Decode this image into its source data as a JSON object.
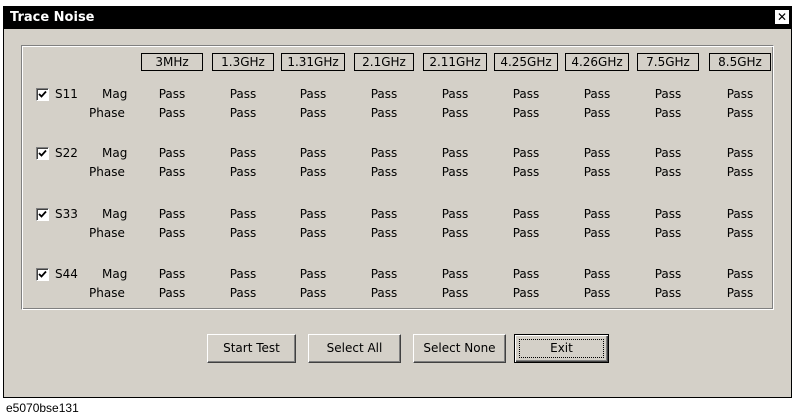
{
  "window": {
    "title": "Trace Noise",
    "close_glyph": "✕"
  },
  "frequencies": [
    "3MHz",
    "1.3GHz",
    "1.31GHz",
    "2.1GHz",
    "2.11GHz",
    "4.25GHz",
    "4.26GHz",
    "7.5GHz",
    "8.5GHz"
  ],
  "ports": [
    {
      "name": "S11",
      "checked": true,
      "rows": [
        {
          "label": "Mag",
          "results": [
            "Pass",
            "Pass",
            "Pass",
            "Pass",
            "Pass",
            "Pass",
            "Pass",
            "Pass",
            "Pass"
          ]
        },
        {
          "label": "Phase",
          "results": [
            "Pass",
            "Pass",
            "Pass",
            "Pass",
            "Pass",
            "Pass",
            "Pass",
            "Pass",
            "Pass"
          ]
        }
      ]
    },
    {
      "name": "S22",
      "checked": true,
      "rows": [
        {
          "label": "Mag",
          "results": [
            "Pass",
            "Pass",
            "Pass",
            "Pass",
            "Pass",
            "Pass",
            "Pass",
            "Pass",
            "Pass"
          ]
        },
        {
          "label": "Phase",
          "results": [
            "Pass",
            "Pass",
            "Pass",
            "Pass",
            "Pass",
            "Pass",
            "Pass",
            "Pass",
            "Pass"
          ]
        }
      ]
    },
    {
      "name": "S33",
      "checked": true,
      "rows": [
        {
          "label": "Mag",
          "results": [
            "Pass",
            "Pass",
            "Pass",
            "Pass",
            "Pass",
            "Pass",
            "Pass",
            "Pass",
            "Pass"
          ]
        },
        {
          "label": "Phase",
          "results": [
            "Pass",
            "Pass",
            "Pass",
            "Pass",
            "Pass",
            "Pass",
            "Pass",
            "Pass",
            "Pass"
          ]
        }
      ]
    },
    {
      "name": "S44",
      "checked": true,
      "rows": [
        {
          "label": "Mag",
          "results": [
            "Pass",
            "Pass",
            "Pass",
            "Pass",
            "Pass",
            "Pass",
            "Pass",
            "Pass",
            "Pass"
          ]
        },
        {
          "label": "Phase",
          "results": [
            "Pass",
            "Pass",
            "Pass",
            "Pass",
            "Pass",
            "Pass",
            "Pass",
            "Pass",
            "Pass"
          ]
        }
      ]
    }
  ],
  "buttons": {
    "start_test": "Start Test",
    "select_all": "Select All",
    "select_none": "Select None",
    "exit": "Exit"
  },
  "caption": "e5070bse131"
}
